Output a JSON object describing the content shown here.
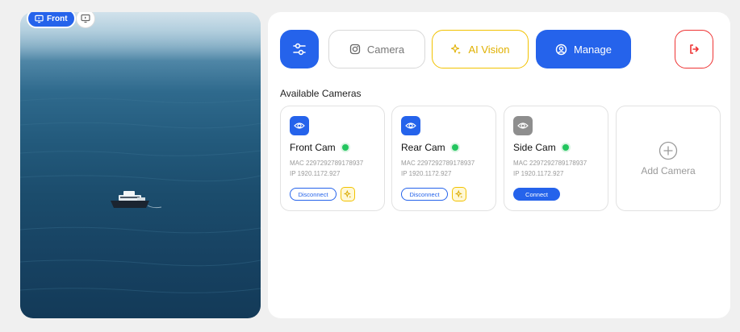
{
  "viewer": {
    "front_chip_label": "Front",
    "alt_view_icon": "monitor-icon"
  },
  "toolbar": {
    "settings_icon": "sliders-icon",
    "camera_label": "Camera",
    "ai_vision_label": "AI Vision",
    "manage_label": "Manage",
    "logout_icon": "logout-icon"
  },
  "section": {
    "title": "Available Cameras"
  },
  "cameras": [
    {
      "name": "Front Cam",
      "mac": "MAC 2297292789178937",
      "ip": "IP 1920.1172.927",
      "action_label": "Disconnect",
      "status": "online"
    },
    {
      "name": "Rear Cam",
      "mac": "MAC 2297292789178937",
      "ip": "IP 1920.1172.927",
      "action_label": "Disconnect",
      "status": "online"
    },
    {
      "name": "Side Cam",
      "mac": "MAC 2297292789178937",
      "ip": "IP 1920.1172.927",
      "action_label": "Connect",
      "status": "online"
    }
  ],
  "add_camera": {
    "label": "Add Camera"
  },
  "colors": {
    "primary": "#2563eb",
    "ai": "#f2c200",
    "danger": "#e33333",
    "online": "#22c55e",
    "inactive": "#8e8e8e"
  }
}
